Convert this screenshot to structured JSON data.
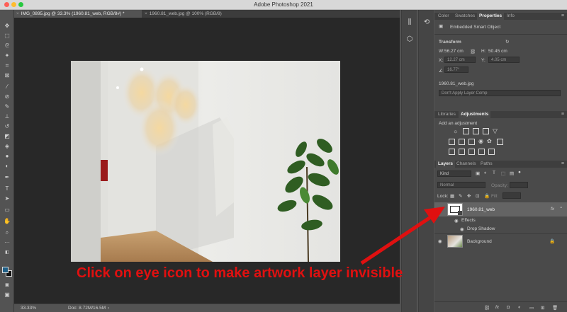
{
  "window": {
    "title": "Adobe Photoshop 2021"
  },
  "tabs": [
    {
      "label": "IMG_0895.jpg @ 33.3% (1960.81_web, RGB/8#) *",
      "close": "×"
    },
    {
      "label": "1960.81_web.jpg @ 100% (RGB/8)",
      "close": "×"
    }
  ],
  "status": {
    "zoom": "33.33%",
    "doc": "Doc: 8.72M/16.5M",
    "arrow": "›"
  },
  "properties_panel": {
    "tabs": [
      "Color",
      "Swatches",
      "Properties",
      "Info"
    ],
    "active_tab": "Properties",
    "object_type": "Embedded Smart Object",
    "section": "Transform",
    "w_label": "W:",
    "w_value": "56.27 cm",
    "h_label": "H:",
    "h_value": "50.45 cm",
    "x_label": "X:",
    "x_value": "12.27 cm",
    "y_label": "Y:",
    "y_value": "4.05 cm",
    "angle_value": "16.77°",
    "file_name": "1960.81_web.jpg",
    "layer_comp_placeholder": "Don't Apply Layer Comp"
  },
  "adjustments_panel": {
    "tabs": [
      "Libraries",
      "Adjustments"
    ],
    "active_tab": "Adjustments",
    "heading": "Add an adjustment"
  },
  "layers_panel": {
    "tabs": [
      "Layers",
      "Channels",
      "Paths"
    ],
    "active_tab": "Layers",
    "filter": "Kind",
    "blend_mode": "Normal",
    "opacity_label": "Opacity:",
    "lock_label": "Lock:",
    "fill_label": "Fill:",
    "layers": [
      {
        "name": "1960.81_web",
        "fx": "fx",
        "effects_label": "Effects",
        "effect": "Drop Shadow"
      },
      {
        "name": "Background"
      }
    ]
  },
  "annotation": {
    "text": "Click on eye icon to make artwork layer invisible"
  },
  "colors": {
    "annotation": "#e01010",
    "foreground_swatch": "#1f5f86",
    "panel_bg": "#4a4a4a"
  }
}
